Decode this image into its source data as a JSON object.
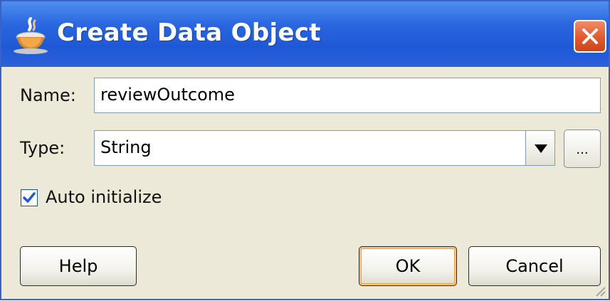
{
  "dialog": {
    "title": "Create Data Object",
    "icon": "oracle-cup-icon",
    "close_icon": "close-icon"
  },
  "form": {
    "name_label": "Name:",
    "name_value": "reviewOutcome",
    "type_label": "Type:",
    "type_value": "String",
    "browse_label": "...",
    "auto_initialize_label": "Auto initialize",
    "auto_initialize_checked": true
  },
  "buttons": {
    "help_label": "Help",
    "ok_label": "OK",
    "cancel_label": "Cancel"
  },
  "colors": {
    "titlebar": "#2a66e0",
    "dialog_bg": "#ece9d8",
    "close_button": "#e05a2c",
    "default_button_highlight": "#e9a649"
  }
}
